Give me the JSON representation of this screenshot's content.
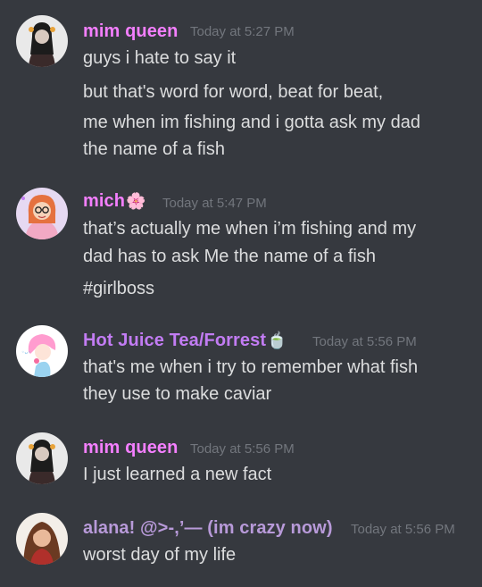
{
  "colors": {
    "background": "#36393f",
    "text": "#dcddde",
    "timestamp": "#72767d",
    "pink_role": "#f47fff",
    "purple_role": "#c27cf3",
    "lavender_role": "#b89ad9"
  },
  "messages": [
    {
      "author": "mim queen",
      "timestamp": "Today at 5:27 PM",
      "lines": [
        "guys i hate to say it",
        "but that's word for word, beat for beat,",
        "me when im fishing and i gotta ask my dad",
        "the name of a fish"
      ]
    },
    {
      "author": "mich",
      "author_emoji": "🌸",
      "timestamp": "Today at 5:47 PM",
      "lines": [
        "that’s actually me when i’m fishing and my",
        "dad has to ask Me the name of a fish",
        "#girlboss"
      ]
    },
    {
      "author": "Hot Juice Tea/Forrest",
      "author_emoji": "🍵",
      "timestamp": "Today at 5:56 PM",
      "lines": [
        "that's me when i try to remember what fish",
        "they use to make caviar"
      ]
    },
    {
      "author": "mim queen",
      "timestamp": "Today at 5:56 PM",
      "lines": [
        "I just learned a new fact"
      ]
    },
    {
      "author": "alana! @>-,’— (im crazy now)",
      "timestamp": "Today at 5:56 PM",
      "lines": [
        "worst day of my life"
      ]
    }
  ]
}
